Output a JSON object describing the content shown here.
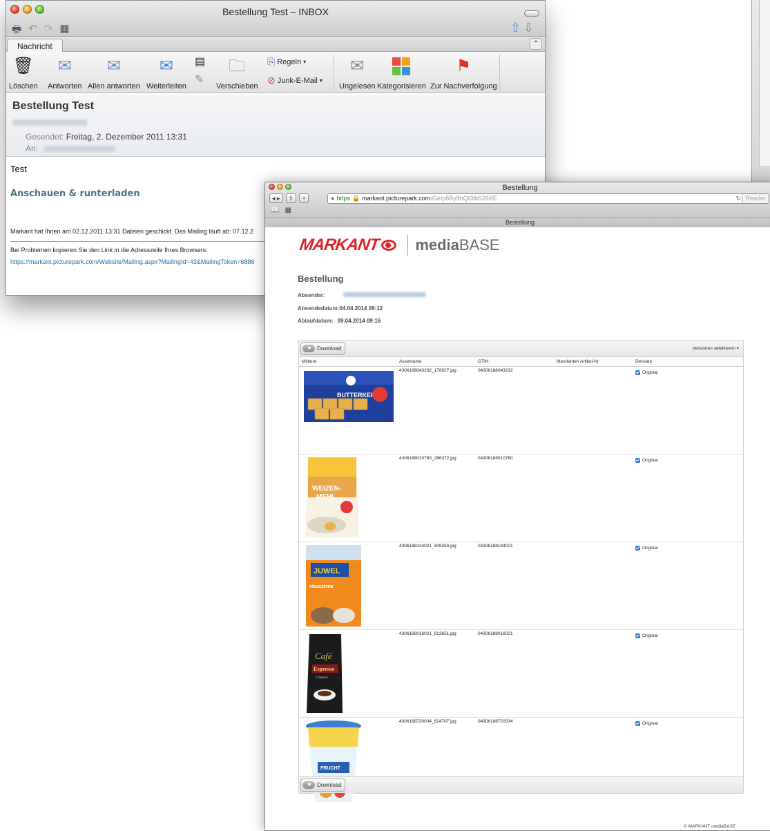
{
  "mail_window": {
    "title": "Bestellung Test – INBOX",
    "tab_label": "Nachricht",
    "ribbon": {
      "delete": "Löschen",
      "reply": "Antworten",
      "reply_all": "Allen antworten",
      "forward": "Weiterleiten",
      "move": "Verschieben",
      "rules": "Regeln",
      "junk": "Junk-E-Mail",
      "unread": "Ungelesen",
      "categorize": "Kategorisieren",
      "follow_up": "Zur Nachverfolgung"
    },
    "subject": "Bestellung Test",
    "sent_label": "Gesendet:",
    "sent_value": "Freitag, 2. Dezember 2011 13:31",
    "to_label": "An:",
    "body_text": "Test",
    "link_text": "Anschauen & runterladen",
    "notice": "Markant hat Ihnen am 02.12.2011 13:31 Dateien geschickt. Das Mailing läuft ab: 07.12.2",
    "problem_text": "Bei Problemen kopieren Sie den Link in die Adresszeile Ihres Browsers:",
    "url_text": "https://markant.picturepark.com/Website/Mailing.aspx?MailingId=43&MailingToken=6886"
  },
  "browser_window": {
    "title": "Bestellung",
    "tab_title": "Bestellung",
    "address": {
      "scheme": "https",
      "host": "markant.picturepark.com",
      "path": "/Go/p6By9bQt3tb526XE",
      "reader": "Reader"
    },
    "logo": {
      "markant": "MARKANT",
      "media": "media",
      "base": "BASE"
    },
    "heading": "Bestellung",
    "sender_label": "Absender:",
    "send_date_label": "Absendedatum:",
    "send_date_value": "04.04.2014 09:12",
    "expiry_label": "Ablaufdatum:",
    "expiry_value": "09.04.2014 09:16",
    "download_label": "Download",
    "versions_label": "Versionen selektieren ▾",
    "columns": [
      "Mittlere",
      "Assetname",
      "GTIN",
      "Mandanten Artikel-Nr",
      "Derivate"
    ],
    "rows": [
      {
        "asset": "4306188043232_178927.jpg",
        "gtin": "04306188043232",
        "derivate": "Original",
        "product": "Butterkeks"
      },
      {
        "asset": "4306188010760_266372.jpg",
        "gtin": "04306188010760",
        "derivate": "Original",
        "product": "Weizenmehl"
      },
      {
        "asset": "4306188144021_808254.jpg",
        "gtin": "04306188144021",
        "derivate": "Original",
        "product": "Juwel Hausstreu"
      },
      {
        "asset": "4306188016021_813651.jpg",
        "gtin": "04306188016021",
        "derivate": "Original",
        "product": "Espresso"
      },
      {
        "asset": "4306188720034_824707.jpg",
        "gtin": "04306188720034",
        "derivate": "Original",
        "product": "Fruchtjoghurt"
      }
    ],
    "footer": "© MARKANT mediaBASE"
  }
}
